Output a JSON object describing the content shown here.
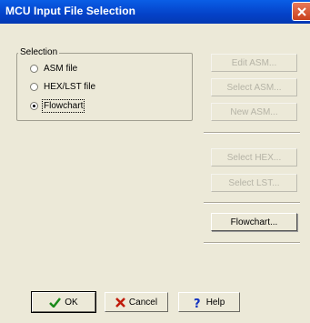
{
  "window": {
    "title": "MCU Input File Selection"
  },
  "selection": {
    "group_label": "Selection",
    "options": [
      {
        "label": "ASM file",
        "selected": false
      },
      {
        "label": "HEX/LST file",
        "selected": false
      },
      {
        "label": "Flowchart",
        "selected": true
      }
    ]
  },
  "right_buttons": {
    "edit_asm": "Edit ASM...",
    "select_asm": "Select ASM...",
    "new_asm": "New ASM...",
    "select_hex": "Select HEX...",
    "select_lst": "Select LST...",
    "flowchart": "Flowchart..."
  },
  "footer": {
    "ok": "OK",
    "cancel": "Cancel",
    "help": "Help"
  },
  "colors": {
    "titlebar": "#0a5ee6",
    "close": "#d2532f",
    "ok_check": "#1a8a1a",
    "cancel_x": "#c01a0a",
    "help_q": "#1030c0"
  },
  "icons": {
    "close": "close-icon",
    "ok": "checkmark-icon",
    "cancel": "x-icon",
    "help": "question-icon"
  }
}
